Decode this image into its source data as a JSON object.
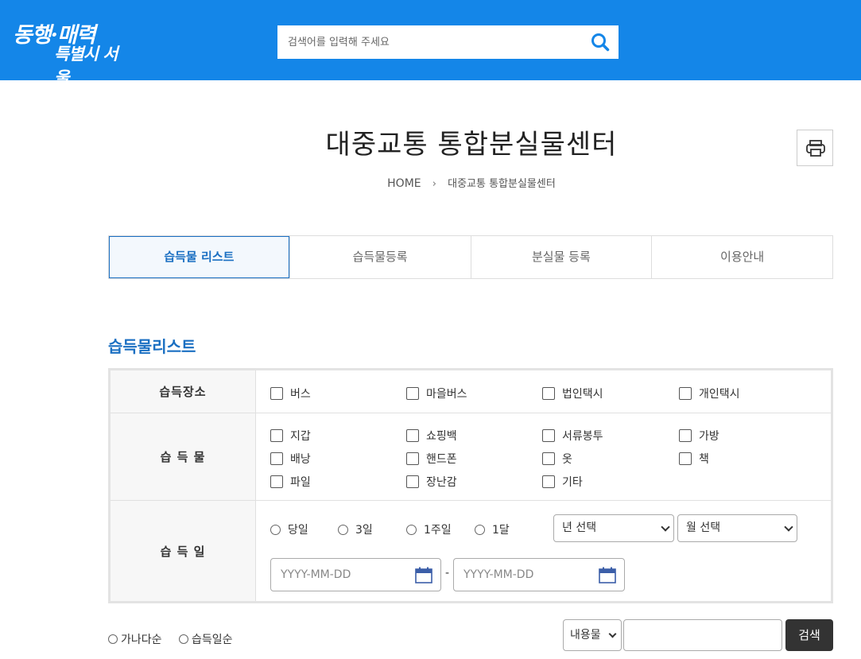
{
  "header": {
    "logo_line1": "동행·매력",
    "logo_line2": "특별시 서울",
    "search_placeholder": "검색어를 입력해 주세요",
    "accent_color": "#1486e8"
  },
  "page": {
    "title": "대중교통 통합분실물센터",
    "breadcrumb_home": "HOME",
    "breadcrumb_current": "대중교통 통합분실물센터"
  },
  "tabs": [
    {
      "label": "습득물 리스트",
      "active": true
    },
    {
      "label": "습득물등록",
      "active": false
    },
    {
      "label": "분실물 등록",
      "active": false
    },
    {
      "label": "이용안내",
      "active": false
    }
  ],
  "section_title": "습득물리스트",
  "filters": {
    "place": {
      "label": "습득장소",
      "options": [
        "버스",
        "마을버스",
        "법인택시",
        "개인택시"
      ]
    },
    "item": {
      "label": "습 득 물",
      "options": [
        "지갑",
        "쇼핑백",
        "서류봉투",
        "가방",
        "배낭",
        "핸드폰",
        "옷",
        "책",
        "파일",
        "장난감",
        "기타"
      ]
    },
    "date": {
      "label": "습 득 일",
      "periods": [
        "당일",
        "3일",
        "1주일",
        "1달"
      ],
      "year_select": "년 선택",
      "month_select": "월 선택",
      "date_placeholder": "YYYY-MM-DD",
      "separator": "-"
    }
  },
  "bottom": {
    "sort_options": [
      "가나다순",
      "습득일순"
    ],
    "search_field_select": "내용물",
    "search_button": "검색"
  }
}
